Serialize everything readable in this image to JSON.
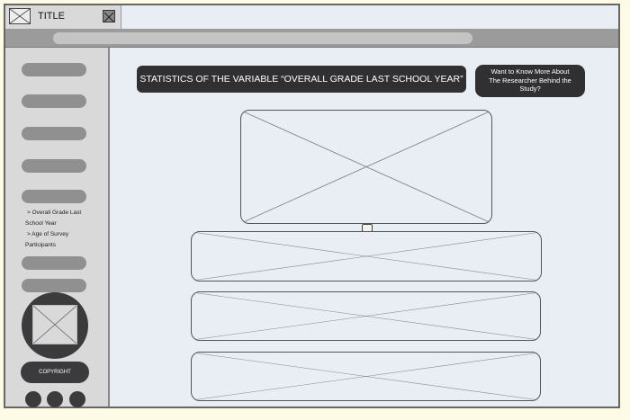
{
  "tab": {
    "title": "TITLE"
  },
  "sidebar": {
    "submenu": [
      "> Overall Grade Last",
      "School Year",
      "> Age of Survey",
      "Participants"
    ],
    "copyright": "COPYRIGHT"
  },
  "main": {
    "title": "STATISTICS OF THE VARIABLE “OVERALL GRADE LAST SCHOOL YEAR”",
    "researcher_button": {
      "line1": "Want to Know More About",
      "line2": "The Researcher Behind the",
      "line3": "Study?"
    }
  },
  "colors": {
    "page_background": "#fdfbe6",
    "dark_button": "#303033",
    "sidebar_background": "#d9d9d9",
    "toolbar": "#9b9b9b"
  }
}
